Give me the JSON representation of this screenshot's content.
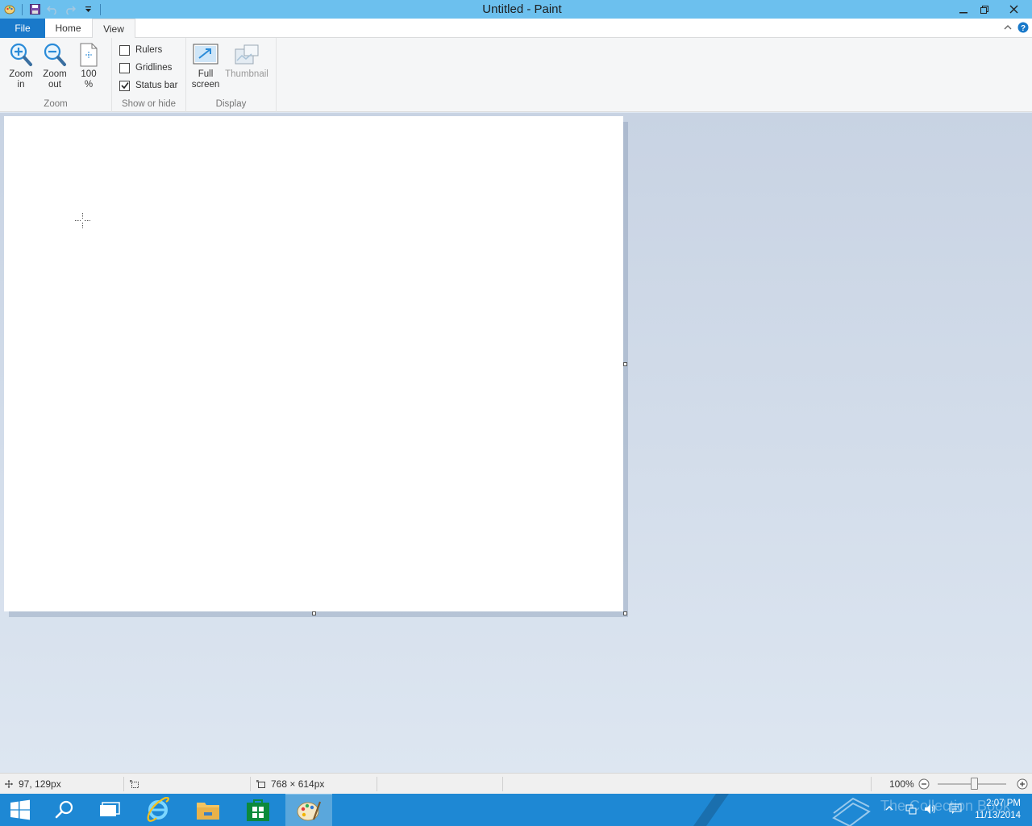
{
  "window": {
    "title": "Untitled - Paint",
    "minimize_icon": "minimize-icon",
    "restore_icon": "restore-icon",
    "close_icon": "close-icon"
  },
  "quick_access": {
    "items": [
      "paint-app-icon",
      "save-icon",
      "undo-icon",
      "redo-icon",
      "customize-quick-access-icon"
    ]
  },
  "ribbon": {
    "tabs": [
      {
        "label": "File"
      },
      {
        "label": "Home"
      },
      {
        "label": "View"
      }
    ],
    "active_tab": "View",
    "groups": {
      "zoom": {
        "label": "Zoom",
        "zoom_in": {
          "line1": "Zoom",
          "line2": "in"
        },
        "zoom_out": {
          "line1": "Zoom",
          "line2": "out"
        },
        "hundred": {
          "line1": "100",
          "line2": "%"
        }
      },
      "show_hide": {
        "label": "Show or hide",
        "rulers": {
          "label": "Rulers",
          "checked": false
        },
        "gridlines": {
          "label": "Gridlines",
          "checked": false
        },
        "status_bar": {
          "label": "Status bar",
          "checked": true
        }
      },
      "display": {
        "label": "Display",
        "full_screen": {
          "line1": "Full",
          "line2": "screen"
        },
        "thumbnail": {
          "label": "Thumbnail",
          "enabled": false
        }
      }
    }
  },
  "statusbar": {
    "cursor_position": "97, 129px",
    "canvas_size": "768 × 614px",
    "zoom_level": "100%",
    "zoom_fraction": 0.5
  },
  "taskbar": {
    "items": [
      "start-icon",
      "search-icon",
      "task-view-icon",
      "internet-explorer-icon",
      "file-explorer-icon",
      "store-icon",
      "paint-taskbar-icon"
    ],
    "clock_time": "2:07 PM",
    "clock_date": "11/13/2014",
    "watermark": "The Collection Book"
  },
  "colors": {
    "titlebar": "#6cc0ee",
    "file_tab": "#1979ca",
    "taskbar": "#1e88d4",
    "workspace": "#dfe8f3"
  }
}
